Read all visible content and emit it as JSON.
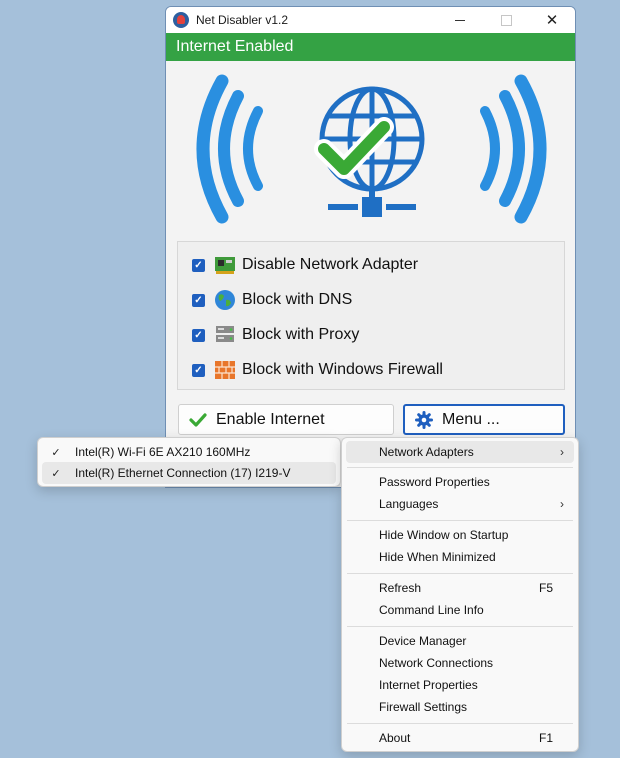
{
  "window": {
    "title": "Net Disabler v1.2",
    "status": "Internet Enabled",
    "status_color": "#34a244"
  },
  "options": [
    {
      "label": "Disable Network Adapter",
      "checked": true,
      "icon": "network-card-icon"
    },
    {
      "label": "Block with DNS",
      "checked": true,
      "icon": "globe-icon"
    },
    {
      "label": "Block with Proxy",
      "checked": true,
      "icon": "proxy-server-icon"
    },
    {
      "label": "Block with Windows Firewall",
      "checked": true,
      "icon": "firewall-icon"
    }
  ],
  "buttons": {
    "enable_label": "Enable Internet",
    "menu_label": "Menu ..."
  },
  "adapters_submenu": [
    {
      "label": "Intel(R) Wi-Fi 6E AX210 160MHz",
      "checked": true
    },
    {
      "label": "Intel(R) Ethernet Connection (17) I219-V",
      "checked": true
    }
  ],
  "menu": {
    "network_adapters": "Network Adapters",
    "password_properties": "Password Properties",
    "languages": "Languages",
    "hide_on_startup": "Hide Window on Startup",
    "hide_when_minimized": "Hide When Minimized",
    "refresh": "Refresh",
    "refresh_accel": "F5",
    "command_line_info": "Command Line Info",
    "device_manager": "Device Manager",
    "network_connections": "Network Connections",
    "internet_properties": "Internet Properties",
    "firewall_settings": "Firewall Settings",
    "about": "About",
    "about_accel": "F1"
  },
  "colors": {
    "accent": "#1f5fbf",
    "wave_blue": "#2a8fe0",
    "check_green": "#3aa935"
  }
}
